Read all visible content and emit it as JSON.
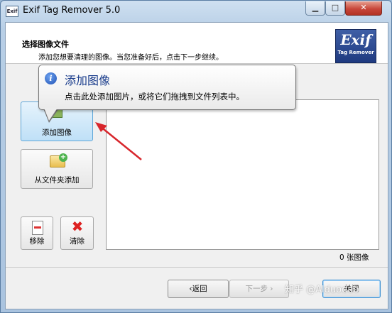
{
  "window": {
    "title": "Exif Tag Remover 5.0",
    "icon_text": "Exif",
    "minimize_label": "▁",
    "maximize_label": "□",
    "close_label": "✕"
  },
  "header": {
    "title": "选择图像文件",
    "subtitle": "添加您想要清理的图像。当您准备好后，点击下一步继续。",
    "logo_big": "Exif",
    "logo_small": "Tag Remover"
  },
  "sidebar": {
    "add_image": "添加图像",
    "add_folder": "从文件夹添加",
    "remove": "移除",
    "clear": "清除"
  },
  "file_list": {
    "count_label": "0 张图像"
  },
  "tooltip": {
    "title": "添加图像",
    "body": "点击此处添加图片，或将它们拖拽到文件列表中。",
    "icon": "i"
  },
  "footer": {
    "back": "‹返回",
    "next": "下一步 ›",
    "close": "关闭"
  },
  "watermark": "知乎 @Alduoduo",
  "colors": {
    "arrow": "#d8262c",
    "tooltip_title": "#1a3d8c",
    "accent": "#3d8fd1"
  }
}
